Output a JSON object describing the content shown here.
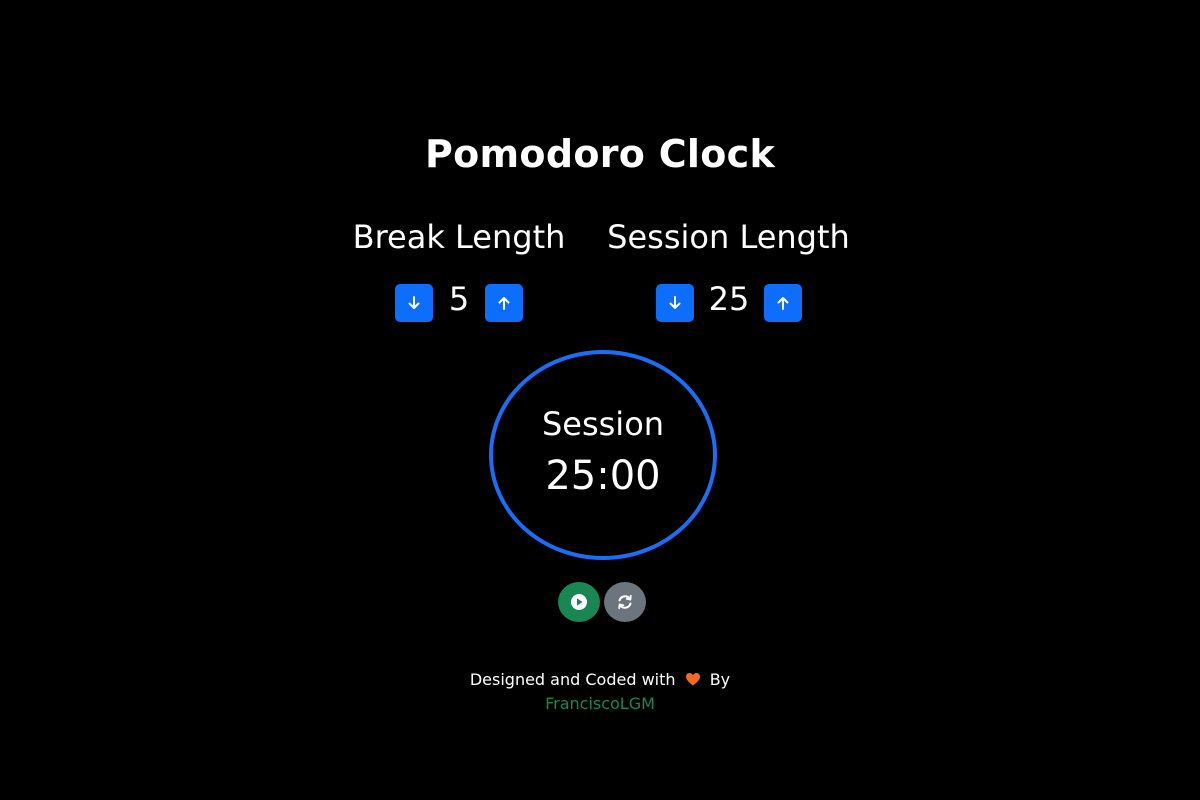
{
  "title": "Pomodoro Clock",
  "break": {
    "label": "Break Length",
    "value": "5",
    "decrement_icon": "arrow-down-icon",
    "increment_icon": "arrow-up-icon"
  },
  "session": {
    "label": "Session Length",
    "value": "25",
    "decrement_icon": "arrow-down-icon",
    "increment_icon": "arrow-up-icon"
  },
  "timer": {
    "label": "Session",
    "time_left": "25:00"
  },
  "controls": {
    "play_icon": "play-icon",
    "reset_icon": "refresh-icon"
  },
  "footer": {
    "text_before": "Designed and Coded with",
    "heart_icon": "heart-icon",
    "text_after": "By",
    "author": "FranciscoLGM"
  },
  "colors": {
    "background": "#000000",
    "primary_button": "#0d6efd",
    "timer_border": "#1a6ef5",
    "play_button": "#198754",
    "reset_button": "#6c757d",
    "heart": "#f26b21",
    "author_link": "#198754"
  }
}
